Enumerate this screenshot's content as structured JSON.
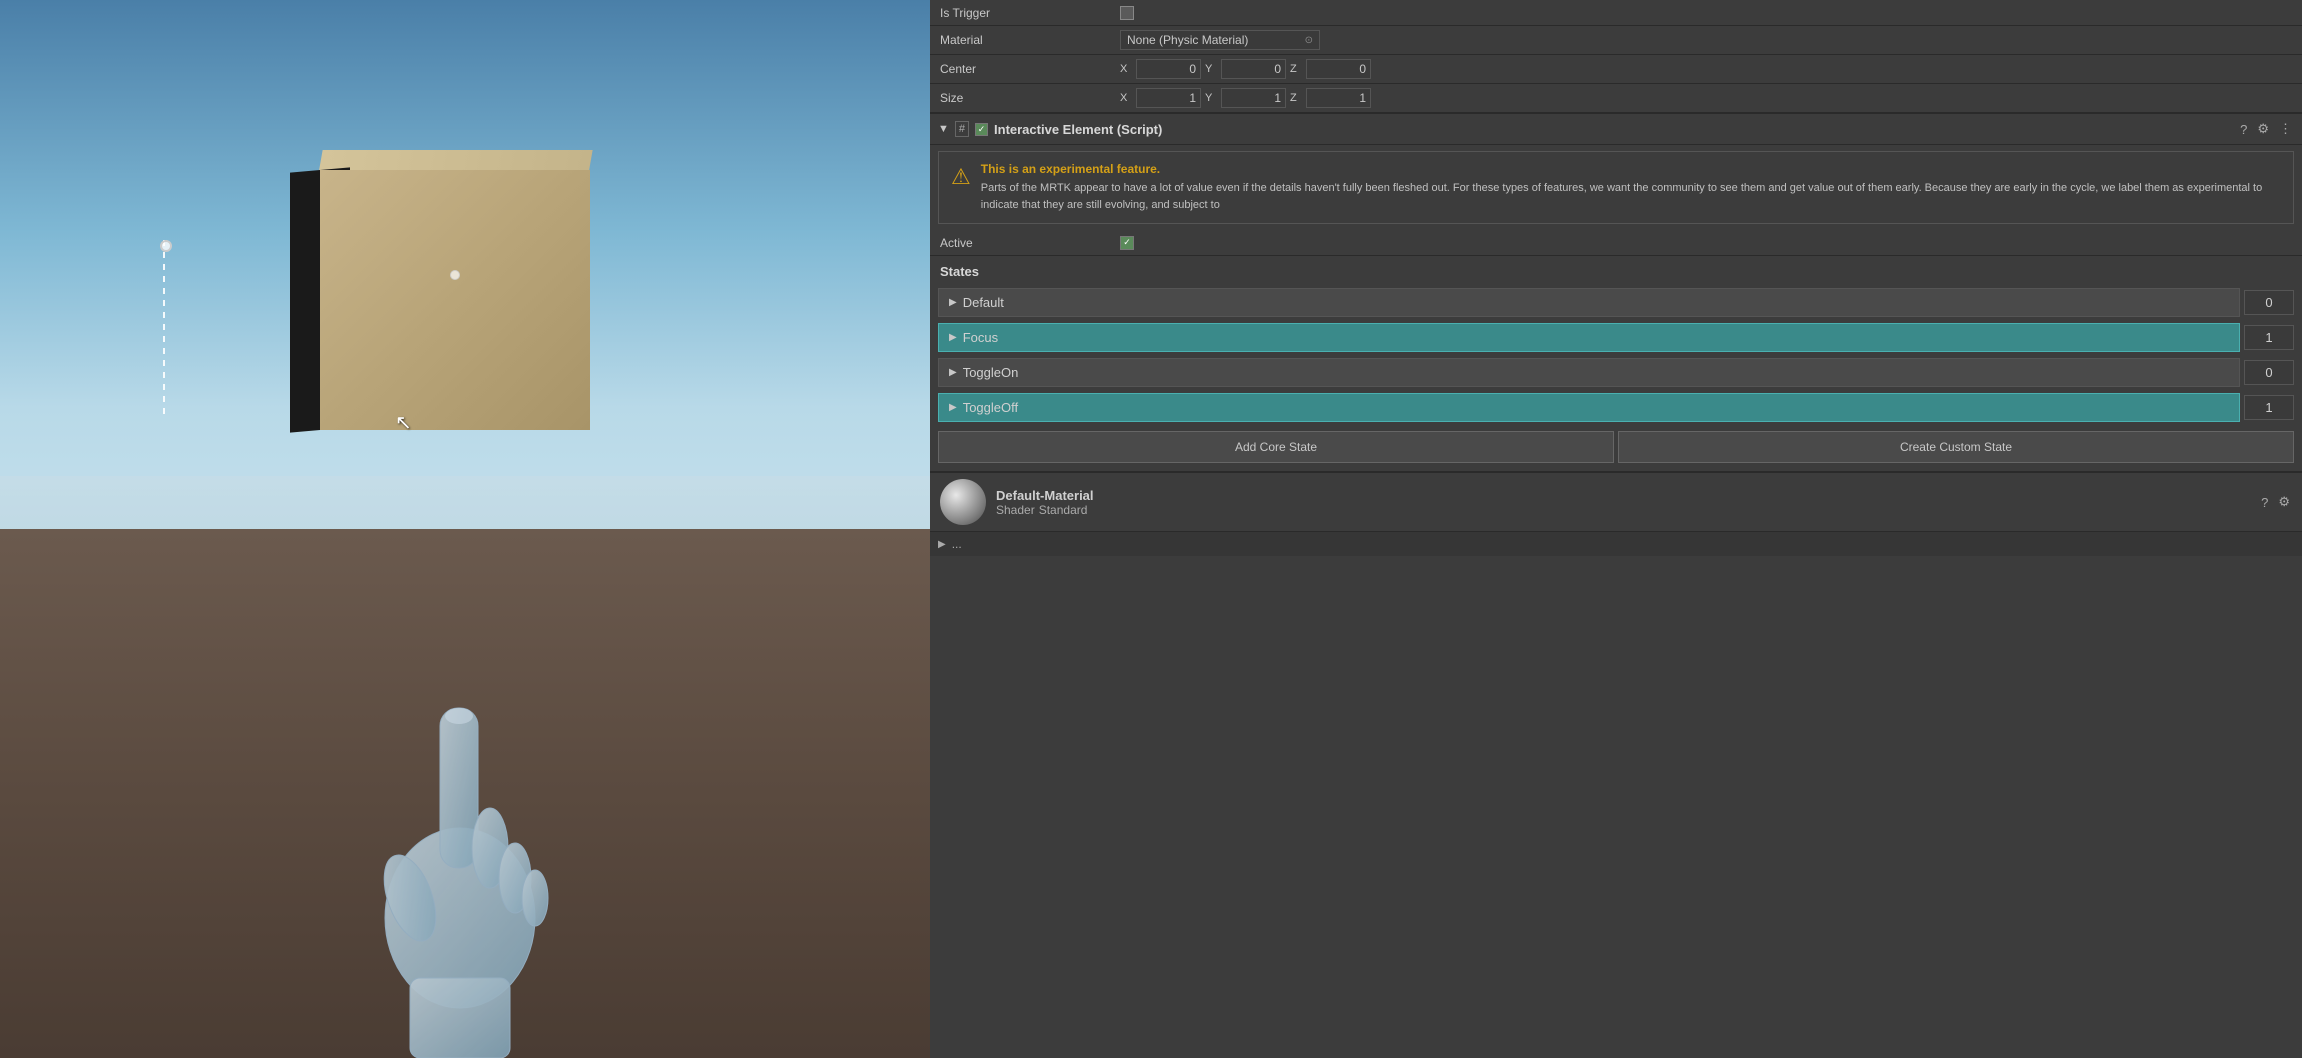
{
  "viewport": {
    "label": "Scene Viewport"
  },
  "inspector": {
    "is_trigger": {
      "label": "Is Trigger",
      "checked": false
    },
    "material": {
      "label": "Material",
      "value": "None (Physic Material)",
      "circle_icon": "⊙"
    },
    "center": {
      "label": "Center",
      "x": "0",
      "y": "0",
      "z": "0"
    },
    "size": {
      "label": "Size",
      "x": "1",
      "y": "1",
      "z": "1"
    },
    "component": {
      "title": "Interactive Element (Script)",
      "hash": "#",
      "checked": true,
      "help_icon": "?",
      "settings_icon": "⚙",
      "menu_icon": "⋮"
    },
    "warning": {
      "title": "This is an experimental feature.",
      "text": "Parts of the MRTK appear to have a lot of value even if the details haven't fully been fleshed out. For these types of features, we want the community to see them and get value out of them early. Because they are early in the cycle, we label them as experimental to indicate that they are still evolving, and subject to"
    },
    "active": {
      "label": "Active",
      "checked": true
    },
    "states": {
      "label": "States",
      "items": [
        {
          "name": "Default",
          "value": "0",
          "active": false
        },
        {
          "name": "Focus",
          "value": "1",
          "active": true
        },
        {
          "name": "ToggleOn",
          "value": "0",
          "active": false
        },
        {
          "name": "ToggleOff",
          "value": "1",
          "active": true
        }
      ]
    },
    "buttons": {
      "add_core": "Add Core State",
      "create_custom": "Create Custom State"
    },
    "material_section": {
      "name": "Default-Material",
      "shader_label": "Shader",
      "shader_value": "Standard"
    }
  }
}
